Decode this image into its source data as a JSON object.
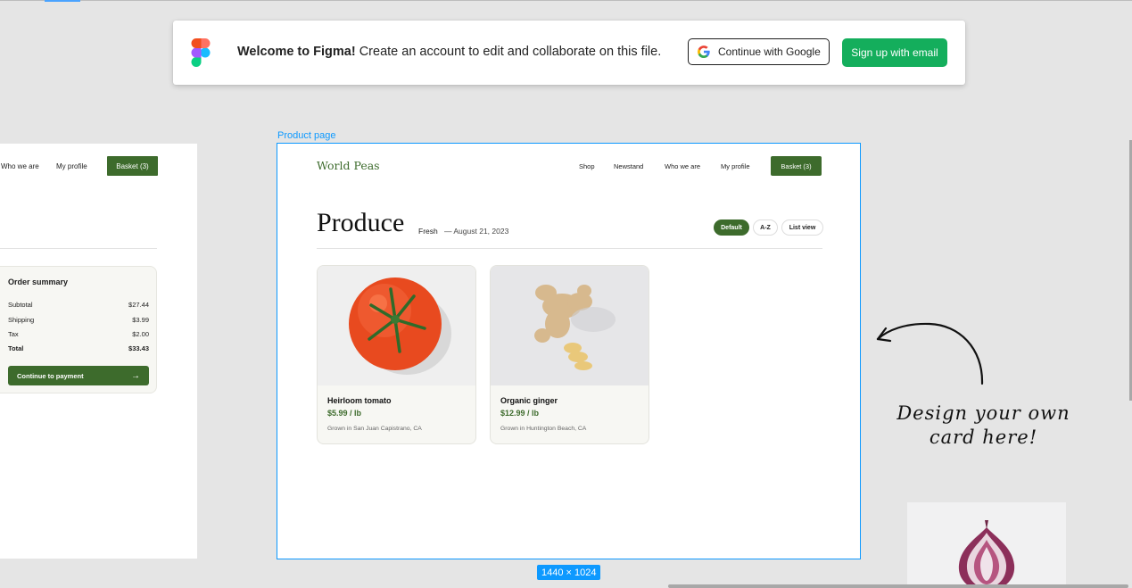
{
  "banner": {
    "welcome_bold": "Welcome to Figma!",
    "welcome_rest": " Create an account to edit and collaborate on this file.",
    "google_button": "Continue with Google",
    "email_button": "Sign up with email"
  },
  "left_frame": {
    "nav": [
      "Who we are",
      "My profile"
    ],
    "basket": "Basket (3)",
    "summary": {
      "title": "Order summary",
      "rows": [
        {
          "label": "Subtotal",
          "value": "$27.44"
        },
        {
          "label": "Shipping",
          "value": "$3.99"
        },
        {
          "label": "Tax",
          "value": "$2.00"
        },
        {
          "label": "Total",
          "value": "$33.43"
        }
      ],
      "button": "Continue to payment",
      "button_arrow": "→"
    }
  },
  "frame": {
    "label": "Product page",
    "size": "1440 × 1024"
  },
  "page": {
    "logo": "World Peas",
    "nav": [
      "Shop",
      "Newstand",
      "Who we are",
      "My profile"
    ],
    "basket": "Basket (3)",
    "title": "Produce",
    "subtitle": "Fresh",
    "date": "— August 21, 2023",
    "filters": [
      "Default",
      "A-Z",
      "List view"
    ],
    "products": [
      {
        "name": "Heirloom tomato",
        "price": "$5.99 / lb",
        "origin": "Grown in San Juan Capistrano, CA"
      },
      {
        "name": "Organic ginger",
        "price": "$12.99 / lb",
        "origin": "Grown in Huntington Beach, CA"
      }
    ]
  },
  "annotation": {
    "line1": "Design your own",
    "line2": "card here!"
  },
  "colors": {
    "brand_green": "#3d6b2c",
    "figma_blue": "#0d99ff",
    "signup_green": "#14ae5c"
  }
}
